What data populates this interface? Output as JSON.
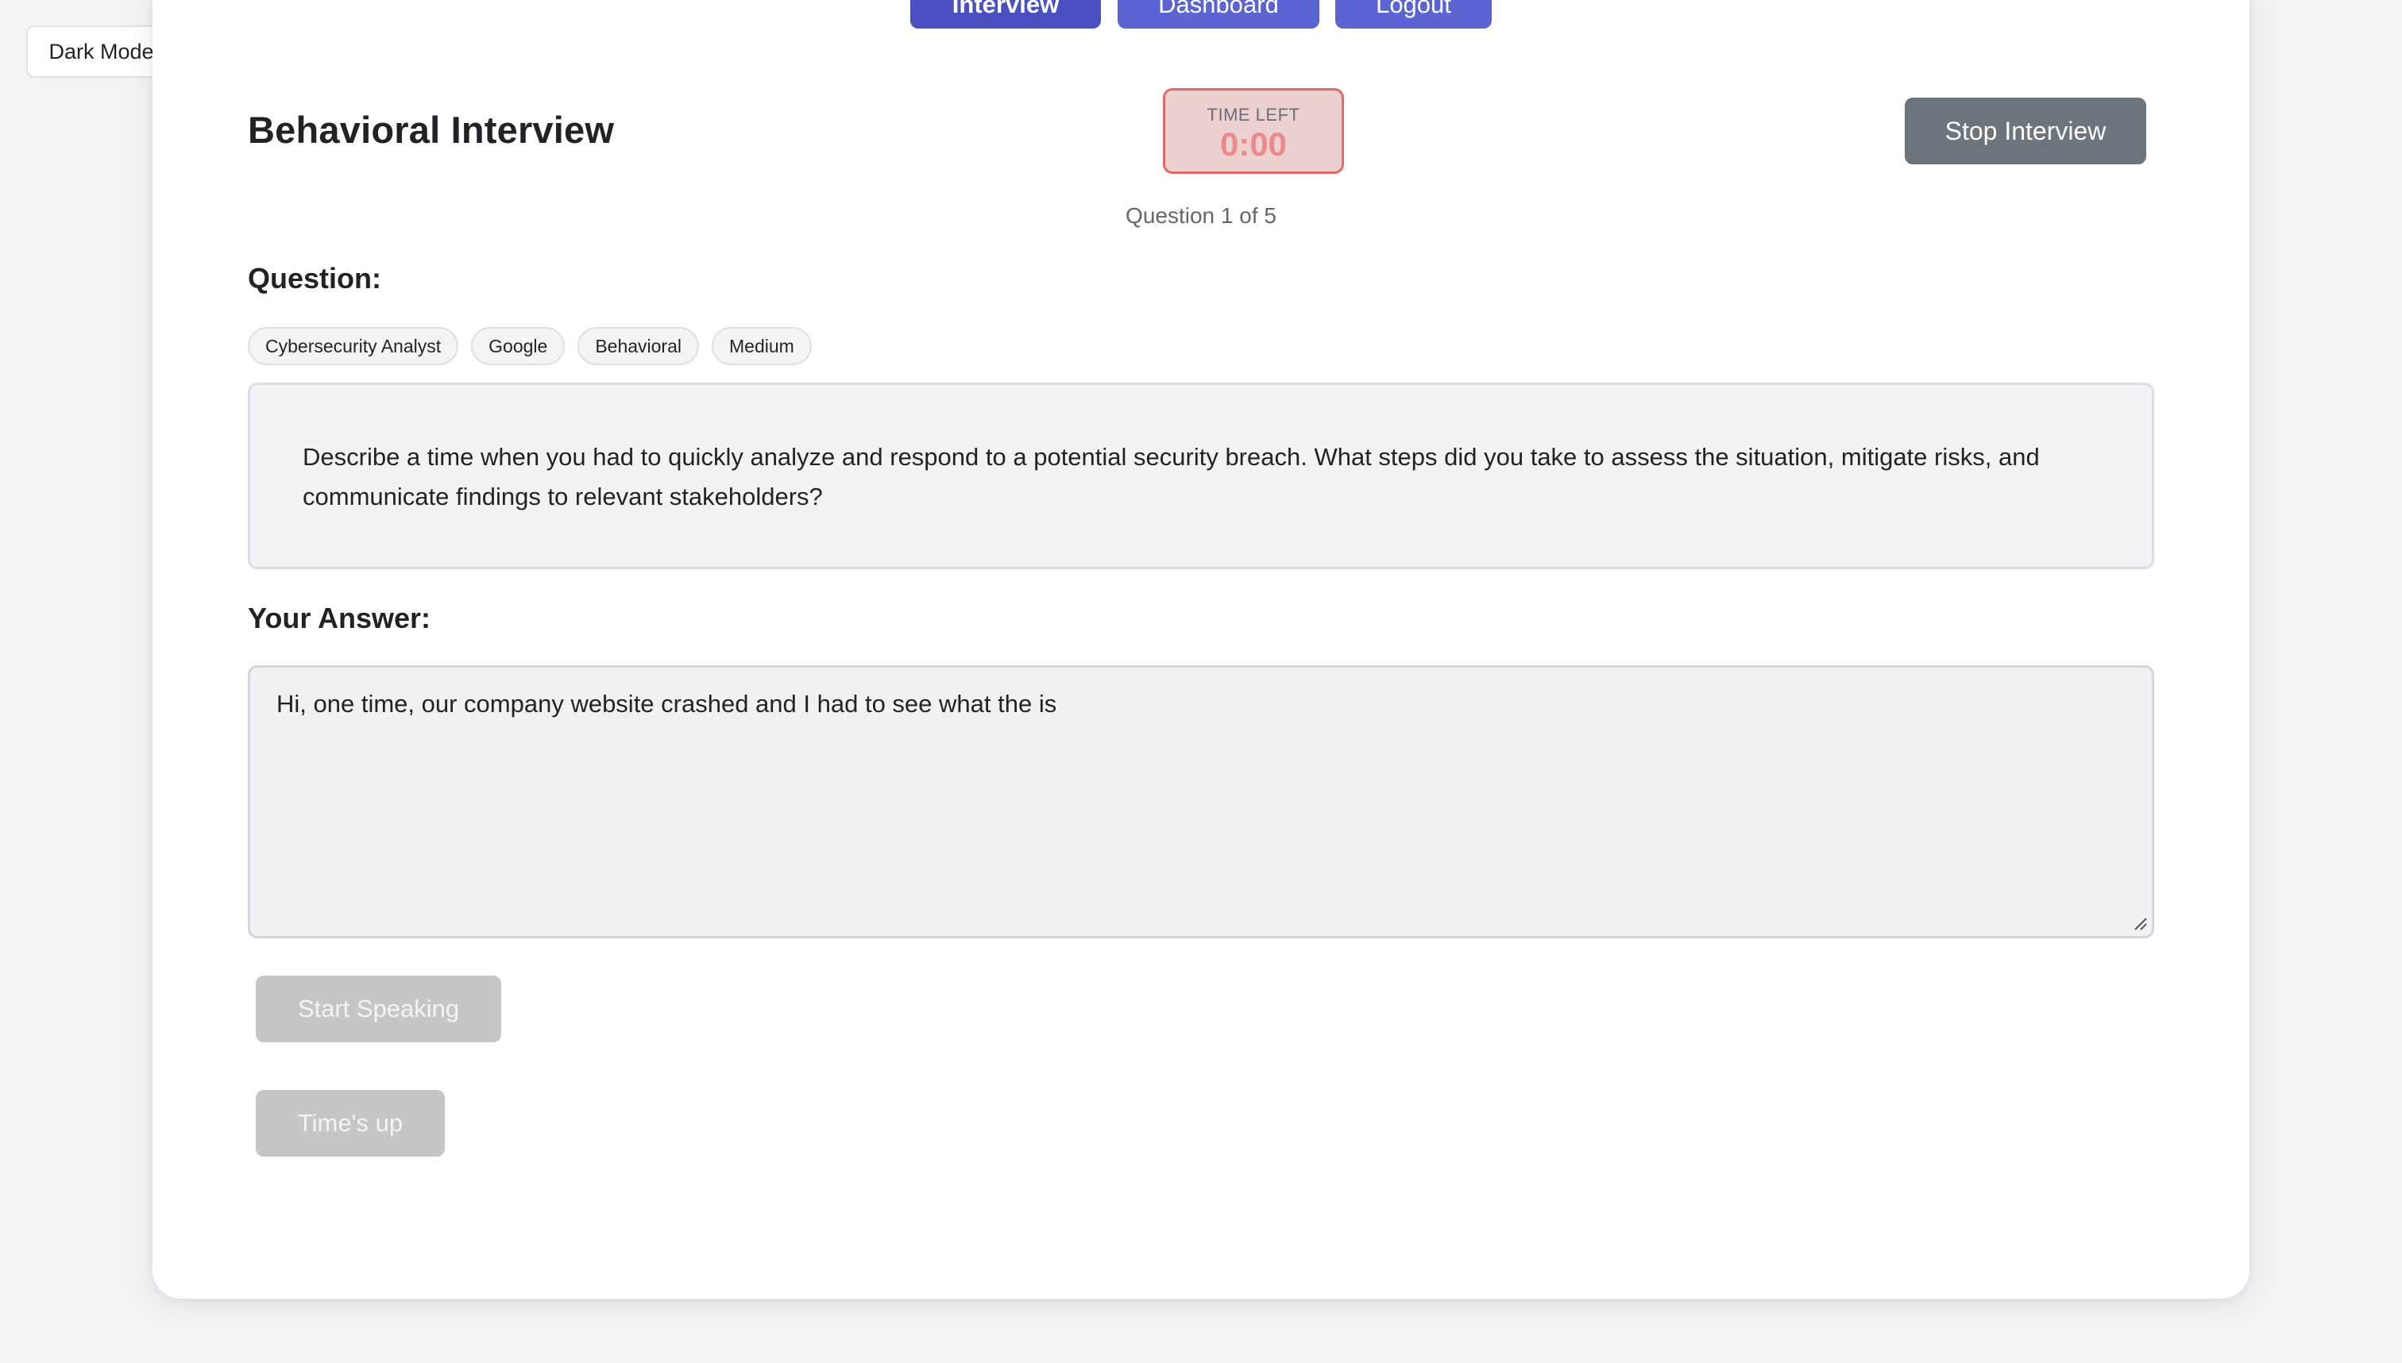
{
  "theme_toggle": {
    "label": "Dark Mode"
  },
  "nav": {
    "items": [
      {
        "label": "Interview",
        "active": true
      },
      {
        "label": "Dashboard",
        "active": false
      },
      {
        "label": "Logout",
        "active": false
      }
    ]
  },
  "header": {
    "title": "Behavioral Interview",
    "timer_label": "TIME LEFT",
    "timer_value": "0:00",
    "stop_label": "Stop Interview",
    "progress": "Question 1 of 5"
  },
  "question": {
    "heading": "Question:",
    "tags": [
      "Cybersecurity Analyst",
      "Google",
      "Behavioral",
      "Medium"
    ],
    "text": "Describe a time when you had to quickly analyze and respond to a potential security breach. What steps did you take to assess the situation, mitigate risks, and communicate findings to relevant stakeholders?"
  },
  "answer": {
    "heading": "Your Answer:",
    "value": "Hi, one time, our company website crashed and I had to see what the is"
  },
  "actions": {
    "speak_label": "Start Speaking",
    "times_up_label": "Time's up"
  },
  "colors": {
    "nav_button": "#5c64d4",
    "nav_button_active": "#4a50c0",
    "stop_button": "#6c747c",
    "timer_background": "#edd0d0",
    "timer_border": "#e46a6a",
    "timer_value": "#ea8a8a",
    "disabled_button": "#c5c6c8"
  }
}
